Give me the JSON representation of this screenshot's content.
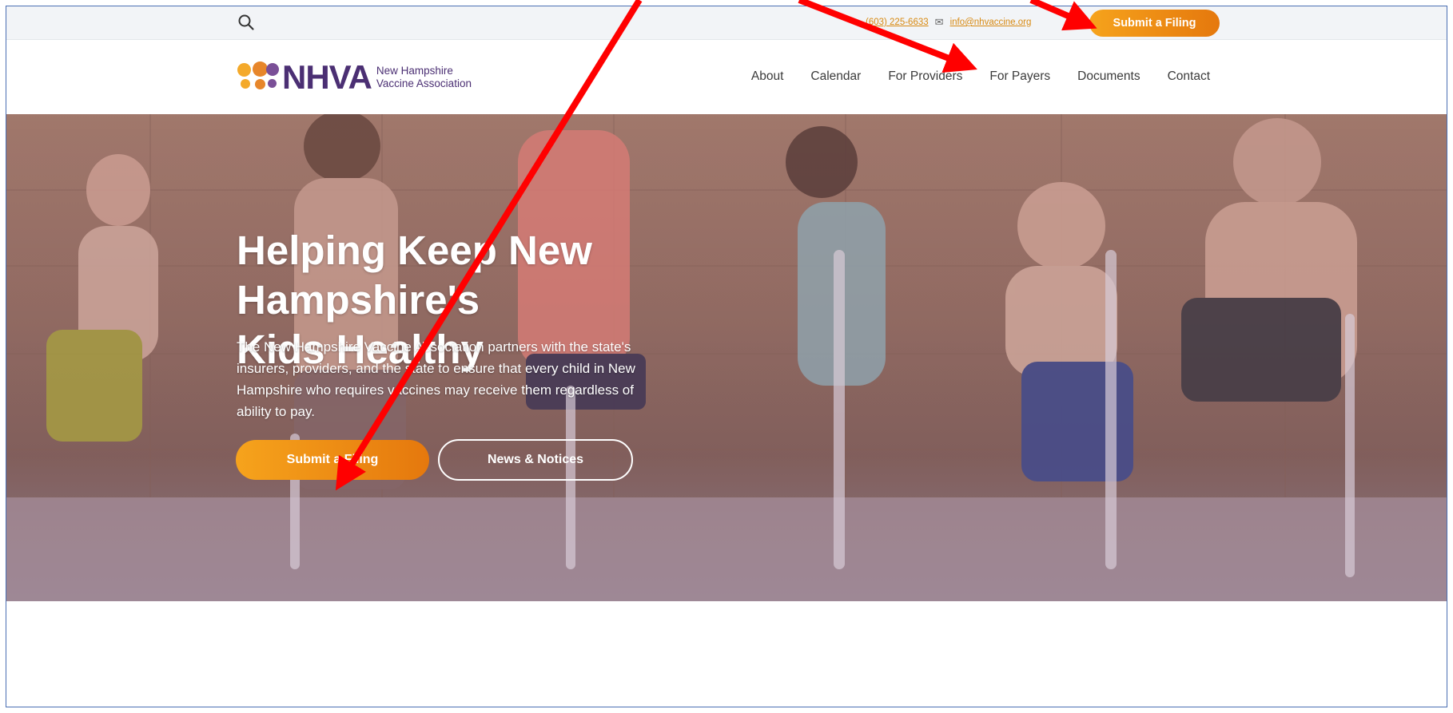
{
  "topbar": {
    "phone": "(603) 225-6633",
    "email": "info@nhvaccine.org",
    "cta_label": "Submit a Filing"
  },
  "logo": {
    "abbr": "NHVA",
    "sub_line1": "New Hampshire",
    "sub_line2": "Vaccine Association"
  },
  "nav": {
    "items": [
      {
        "label": "About"
      },
      {
        "label": "Calendar"
      },
      {
        "label": "For Providers"
      },
      {
        "label": "For Payers"
      },
      {
        "label": "Documents"
      },
      {
        "label": "Contact"
      }
    ]
  },
  "hero": {
    "title_line1": "Helping Keep New Hampshire's",
    "title_line2": "Kids Healthy",
    "description": "The New Hampshire Vaccine Association partners with the state's insurers, providers, and the state to ensure that every child in New Hampshire who requires vaccines may receive them regardless of ability to pay.",
    "primary_button": "Submit a Filing",
    "secondary_button": "News & Notices"
  },
  "colors": {
    "accent_orange": "#f08a12",
    "brand_purple": "#4b2f73",
    "annotation_red": "#ff0000"
  }
}
